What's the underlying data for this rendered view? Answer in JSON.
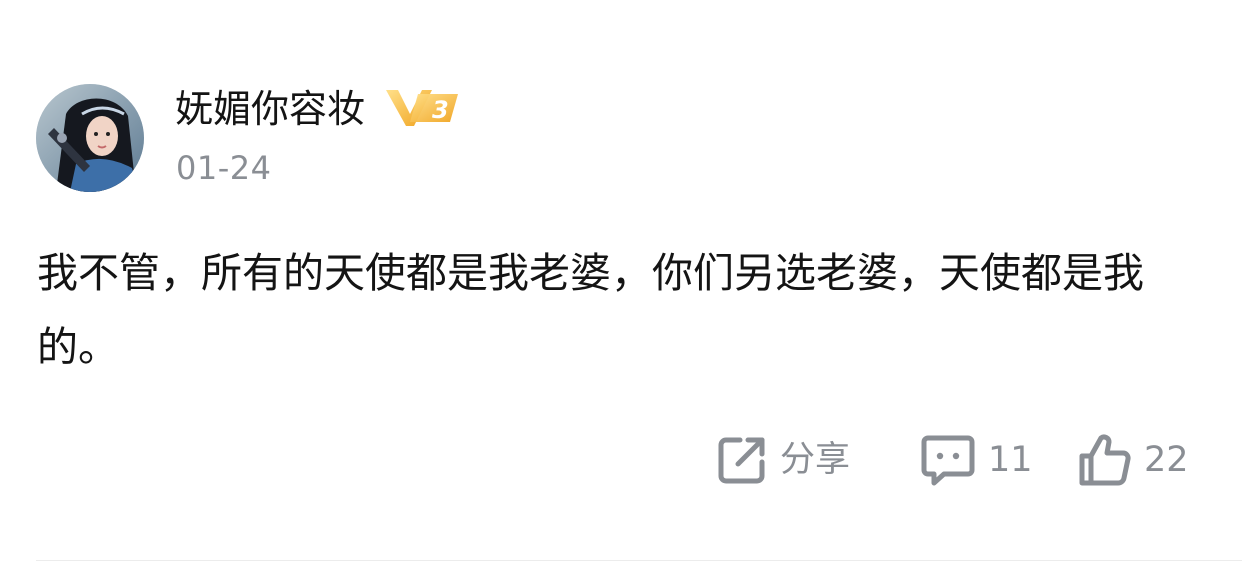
{
  "post": {
    "author": {
      "name": "妩媚你容妆",
      "vip_level": "3",
      "avatar_icon": "avatar-photo"
    },
    "timestamp": "01-24",
    "content": "我不管，所有的天使都是我老婆，你们另选老婆，天使都是我的。",
    "actions": {
      "share_label": "分享",
      "comment_count": "11",
      "like_count": "22"
    }
  },
  "colors": {
    "text_primary": "#141414",
    "text_secondary": "#8a8e94",
    "vip_gold": "#f5b92e",
    "divider": "#ececec"
  },
  "icons": [
    "share-icon",
    "comment-icon",
    "like-icon",
    "vip-badge-icon"
  ]
}
